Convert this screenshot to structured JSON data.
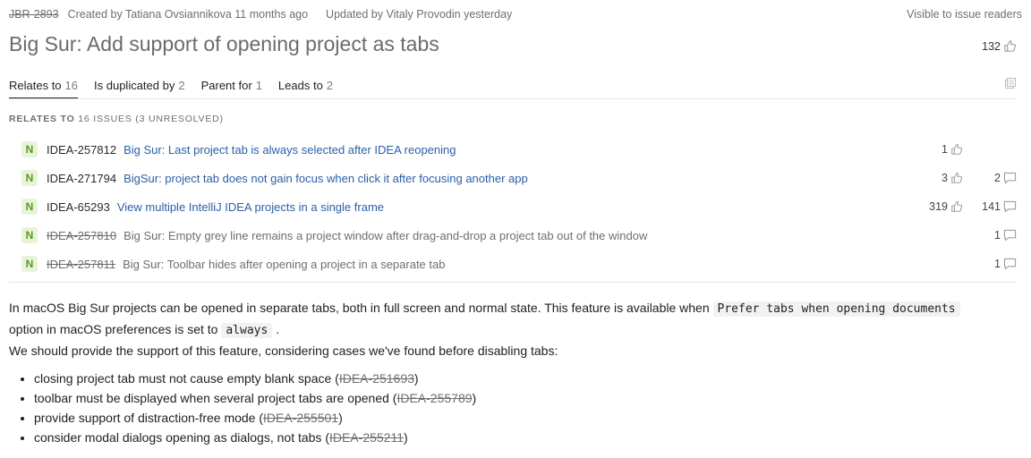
{
  "header": {
    "issue_id": "JBR-2893",
    "created_text": "Created by Tatiana Ovsiannikova 11 months ago",
    "updated_text": "Updated by Vitaly Provodin yesterday",
    "visibility": "Visible to issue readers",
    "title": "Big Sur: Add support of opening project as tabs",
    "votes": "132"
  },
  "tabs": [
    {
      "label": "Relates to",
      "count": "16"
    },
    {
      "label": "Is duplicated by",
      "count": "2"
    },
    {
      "label": "Parent for",
      "count": "1"
    },
    {
      "label": "Leads to",
      "count": "2"
    }
  ],
  "section": {
    "label_strong": "RELATES TO",
    "label_rest": " 16 ISSUES (3 UNRESOLVED)"
  },
  "issues": [
    {
      "state": "N",
      "key": "IDEA-257812",
      "summary": "Big Sur: Last project tab is always selected after IDEA reopening",
      "votes": "1",
      "comments": "",
      "resolved": false
    },
    {
      "state": "N",
      "key": "IDEA-271794",
      "summary": "BigSur: project tab does not gain focus when click it after focusing another app",
      "votes": "3",
      "comments": "2",
      "resolved": false
    },
    {
      "state": "N",
      "key": "IDEA-65293",
      "summary": "View multiple IntelliJ IDEA projects in a single frame",
      "votes": "319",
      "comments": "141",
      "resolved": false
    },
    {
      "state": "N",
      "key": "IDEA-257810",
      "summary": "Big Sur: Empty grey line remains a project window after drag-and-drop a project tab out of the window",
      "votes": "",
      "comments": "1",
      "resolved": true
    },
    {
      "state": "N",
      "key": "IDEA-257811",
      "summary": "Big Sur: Toolbar hides after opening a project in a separate tab",
      "votes": "",
      "comments": "1",
      "resolved": true
    }
  ],
  "description": {
    "p1_a": "In macOS Big Sur projects can be opened in separate tabs, both in full screen and normal state. This feature is available when ",
    "p1_code1": "Prefer tabs when opening documents",
    "p1_b": "option in macOS preferences is set to ",
    "p1_code2": "always",
    "p1_c": " .",
    "p2": "We should provide the support of this feature, considering cases we've found before disabling tabs:",
    "bullets": [
      {
        "text": "closing project tab must not cause empty blank space (",
        "ref": "IDEA-251693",
        "end": ")"
      },
      {
        "text": "toolbar must be displayed when several project tabs are opened (",
        "ref": "IDEA-255789",
        "end": ")"
      },
      {
        "text": "provide support of distraction-free mode (",
        "ref": "IDEA-255501",
        "end": ")"
      },
      {
        "text": "consider modal dialogs opening as dialogs, not tabs (",
        "ref": "IDEA-255211",
        "end": ")"
      }
    ]
  },
  "colors": {
    "link": "#2b5fa8",
    "badge_bg": "#e8f4d9",
    "badge_fg": "#5a9a1c"
  },
  "icons": {
    "vote": "thumbs-up-icon",
    "comment": "comment-bubble-icon",
    "copy": "copy-icon"
  }
}
